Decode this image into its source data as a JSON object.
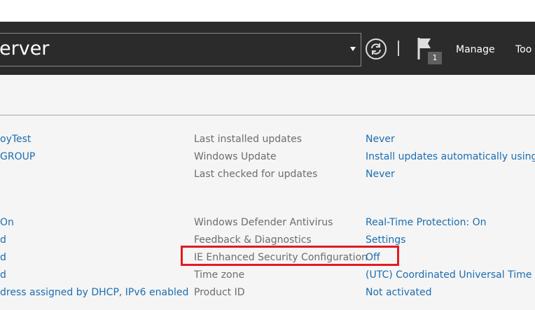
{
  "header": {
    "breadcrumb": "erver",
    "notification_count": "1",
    "menu": {
      "manage": "Manage",
      "tools": "Too"
    }
  },
  "properties": {
    "left_values": [
      "oyTest",
      "GROUP",
      "On",
      "d",
      "d",
      "d",
      "dress assigned by DHCP, IPv6 enabled"
    ],
    "rows": [
      {
        "label": "Last installed updates",
        "value": "Never"
      },
      {
        "label": "Windows Update",
        "value": "Install updates automatically using W"
      },
      {
        "label": "Last checked for updates",
        "value": "Never"
      },
      {
        "label": "Windows Defender Antivirus",
        "value": "Real-Time Protection: On"
      },
      {
        "label": "Feedback & Diagnostics",
        "value": "Settings"
      },
      {
        "label": "IE Enhanced Security Configuration",
        "value": "Off"
      },
      {
        "label": "Time zone",
        "value": "(UTC) Coordinated Universal Time"
      },
      {
        "label": "Product ID",
        "value": "Not activated"
      }
    ]
  },
  "colors": {
    "header_bg": "#2b2b2b",
    "content_bg": "#f5f5f5",
    "label_text": "#6d6d6d",
    "link_text": "#1c6db0",
    "highlight_border": "#e11b22"
  },
  "icons": [
    "refresh-icon",
    "flag-icon",
    "chevron-down-icon"
  ]
}
